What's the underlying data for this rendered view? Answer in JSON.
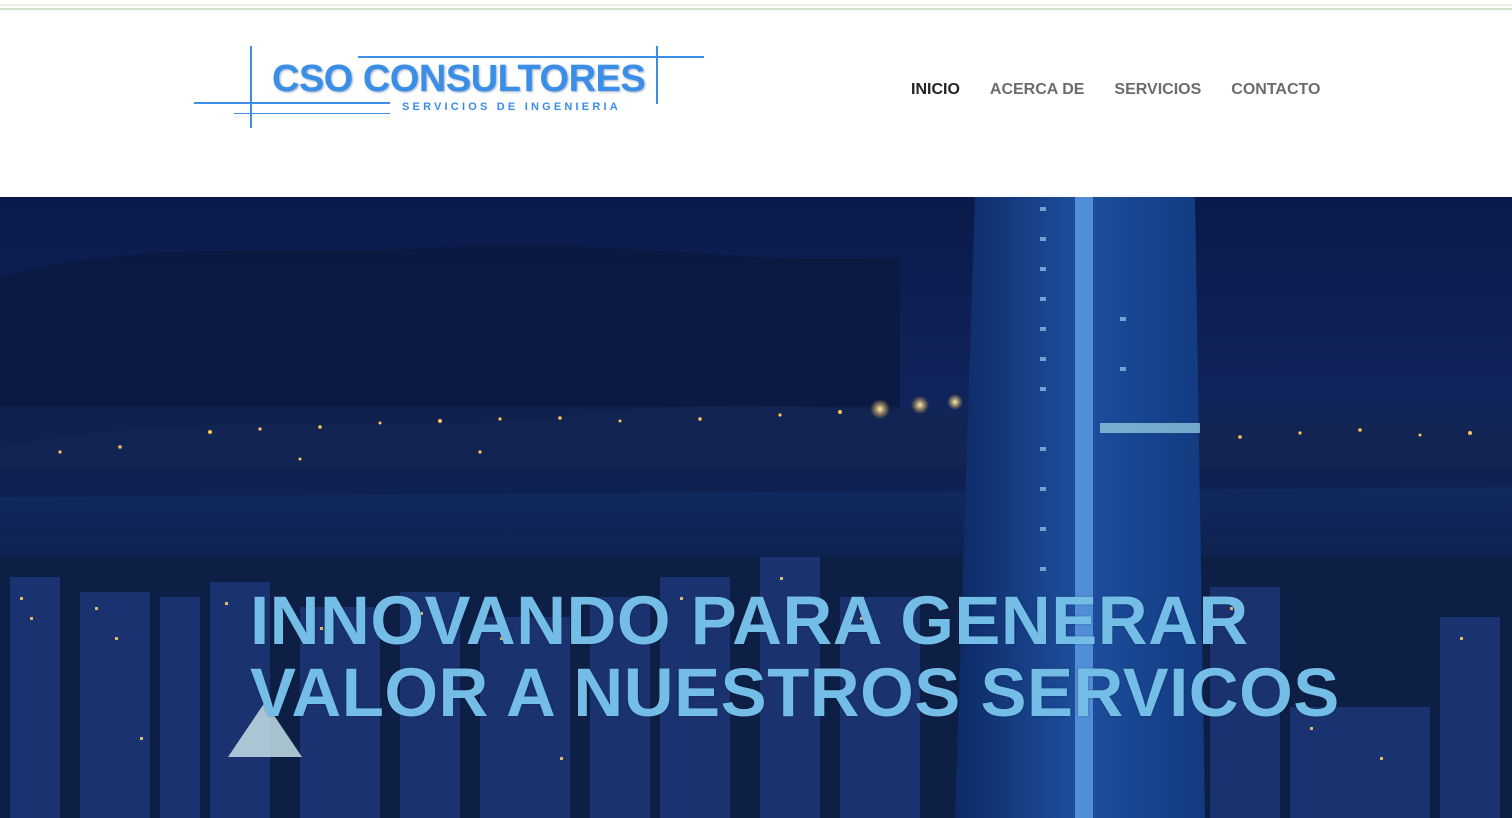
{
  "logo": {
    "title": "CSO CONSULTORES",
    "subtitle": "SERVICIOS DE INGENIERIA"
  },
  "nav": {
    "items": [
      {
        "label": "INICIO",
        "active": true
      },
      {
        "label": "ACERCA DE",
        "active": false
      },
      {
        "label": "SERVICIOS",
        "active": false
      },
      {
        "label": "CONTACTO",
        "active": false
      }
    ]
  },
  "hero": {
    "headline_line1": "INNOVANDO PARA GENERAR",
    "headline_line2": "VALOR A NUESTROS SERVICOS"
  },
  "colors": {
    "brand": "#3a8ee6",
    "headline": "#74bde6",
    "nav_active": "#222222",
    "nav": "#6c6c6c",
    "hero_sky": "#0a1a4a"
  }
}
